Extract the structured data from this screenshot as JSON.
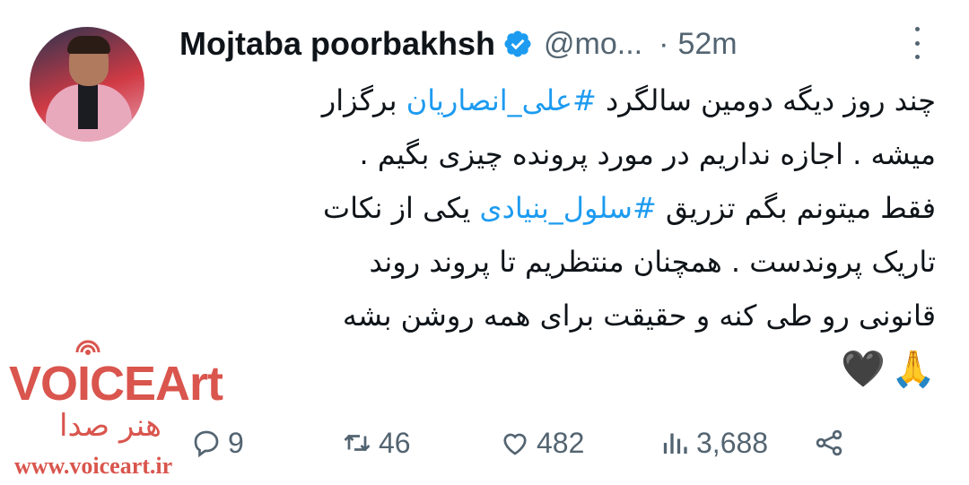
{
  "author": {
    "name": "Mojtaba poorbakhsh",
    "handle": "@mo...",
    "separator": "·",
    "time": "52m",
    "verified": true
  },
  "tweet": {
    "lines": [
      [
        "چند روز دیگه دومین سالگرد ",
        "#علی_انصاریان",
        " برگزار"
      ],
      [
        "میشه . اجازه نداریم در مورد پرونده چیزی بگیم ."
      ],
      [
        "فقط میتونم بگم تزریق ",
        "#سلول_بنیادی",
        " یکی از نکات"
      ],
      [
        "تاریک پروندست  . همچنان منتظریم تا پروند روند"
      ],
      [
        "قانونی رو طی کنه و حقیقت برای همه روشن بشه"
      ]
    ],
    "emojis": [
      "🙏",
      "🖤"
    ]
  },
  "actions": {
    "replies": "9",
    "retweets": "46",
    "likes": "482",
    "views": "3,688"
  },
  "watermark": {
    "title": "VOICEArt",
    "subtitle": "هنر صدا",
    "url": "www.voiceart.ir"
  },
  "colors": {
    "accent": "#1d9bf0",
    "text": "#0f1419",
    "muted": "#536471",
    "watermark": "#d9554d"
  },
  "icons": {
    "verified": "verified-badge-icon",
    "more": "more-options-icon",
    "reply": "reply-icon",
    "retweet": "retweet-icon",
    "like": "heart-icon",
    "views": "views-icon",
    "share": "share-icon"
  }
}
